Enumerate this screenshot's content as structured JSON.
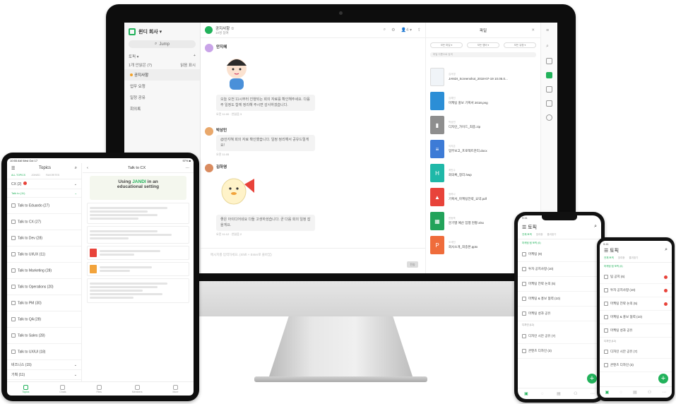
{
  "desktop": {
    "team": "윈디 회사 ▾",
    "jump": "Jump",
    "topic_section": "토픽 ▾",
    "topic_section_right": "+",
    "topic_sub": "1개 안읽은 (?)",
    "topic_sub_right": "읽음 표시",
    "topics": [
      "공지사항",
      "업무 요청",
      "일정 공유",
      "회의록"
    ],
    "chat_title": "공지사항 ☆",
    "chat_sub": "10명 참여",
    "chat_tools": [
      "⌕",
      "⚙",
      "👤4 ▾",
      "⇪"
    ],
    "messages": [
      {
        "name": "안지혜",
        "text": "오늘 오전 11시부터 진행되는 회의 자료를 확인해주세요. 다음 주 일정도 함께 정리해 주시면 감사하겠습니다.",
        "meta": "오전 11:00 · 안읽음 3"
      },
      {
        "name": "박상민",
        "text": "@안지혜 회의 자료 확인했습니다. 일정 정리해서 공유드릴게요!",
        "meta": "오전 11:05"
      },
      {
        "name": "김하영",
        "text": "좋은 아이디어네요 다들 고생하셨습니다. 곧 다음 회의 일정 잡을게요.",
        "meta": "오전 11:12 · 안읽음 2"
      }
    ],
    "composer_placeholder": "메시지를 입력하세요. (Shift + Enter로 줄바꿈)",
    "send": "전송",
    "files_title": "파일",
    "filters": [
      "모든 파일 ▾",
      "모든 멤버 ▾",
      "모든 유형 ▾"
    ],
    "file_search": "파일 이름으로 검색",
    "files": [
      {
        "name": "JANDI_Screenshot_2018-07-19 10.05.0...",
        "author": "김서영",
        "color": "#ffffff",
        "icon": "image-thumb"
      },
      {
        "name": "마케팅 홍보 기획서 2018.png",
        "author": "김해진",
        "color": "#2b8ed6",
        "icon": "image-thumb"
      },
      {
        "name": "디자인_가이드_최종.zip",
        "author": "박상민",
        "color": "#8e8e8e",
        "icon": "zip"
      },
      {
        "name": "업무보고_프로젝트관리.docx",
        "author": "이지은",
        "color": "#3d7bd6",
        "icon": "doc"
      },
      {
        "name": "회의록_정리.hwp",
        "author": "최민수",
        "color": "#1fb8a8",
        "icon": "hwp"
      },
      {
        "name": "기획서_마케팅전략_요약.pdf",
        "author": "정하나",
        "color": "#e8433a",
        "icon": "pdf"
      },
      {
        "name": "분기별 예산 집행 현황.xlsx",
        "author": "한동욱",
        "color": "#22a35a",
        "icon": "xls"
      },
      {
        "name": "회사소개_최종본.pptx",
        "author": "오세진",
        "color": "#ef6c3b",
        "icon": "ppt"
      }
    ]
  },
  "ipad": {
    "status_left": "10:55 AM  Wed Oct 17",
    "status_right": "97% ■",
    "title": "Topics",
    "tabs": [
      "ALL TOPICS",
      "JOINED",
      "FAVORITES"
    ],
    "section1": "CX (2)",
    "section2": "Talk to (11)",
    "rows": [
      "Talk to Eduardo (27)",
      "Talk to CX (27)",
      "Talk to Dev (28)",
      "Talk to UI/UX (11)",
      "Talk to Marketing (28)",
      "Talk to Operations (20)",
      "Talk to PM (30)",
      "Talk to QA (28)",
      "Talk to Sales (28)",
      "Talk to UX/UI (18)"
    ],
    "section3": "비즈니스 (15)",
    "section4": "기획 (11)",
    "chat_title": "Talk to CX",
    "banner_line1": "Using",
    "banner_brand": "JANDI",
    "banner_line1b": "in an",
    "banner_line2": "educational setting",
    "nav": [
      "Topics",
      "Chats",
      "Files",
      "Members",
      "More"
    ]
  },
  "phone1": {
    "status": "9:41",
    "title": "토픽",
    "tabs": [
      "전체 토픽",
      "참여중",
      "즐겨찾기"
    ],
    "section": "마케팅 팀 토픽 (6)",
    "rows": [
      "마케팅 (9)",
      "투자 공지사항 (10)",
      "마케팅 전략 논의 (5)",
      "마케팅 & 홍보 협력 (10)",
      "마케팅 성과 공유",
      "디자인 시안 공유 (7)",
      "콘텐츠 디자인 (3)"
    ],
    "section2": "디자인 (12)"
  },
  "phone2": {
    "status": "9:41",
    "title": "토픽",
    "tabs": [
      "전체 토픽",
      "참여중",
      "즐겨찾기"
    ],
    "section": "마케팅 팀 토픽 (6)",
    "rows": [
      "팀 공지 (6)",
      "투자 공지사항 (10)",
      "마케팅 전략 논의 (5)",
      "마케팅 & 홍보 협력 (10)",
      "마케팅 성과 공유"
    ],
    "section2": "디자인 (12)",
    "rows2": [
      "디자인 시안 공유 (7)",
      "콘텐츠 디자인 (3)"
    ]
  }
}
